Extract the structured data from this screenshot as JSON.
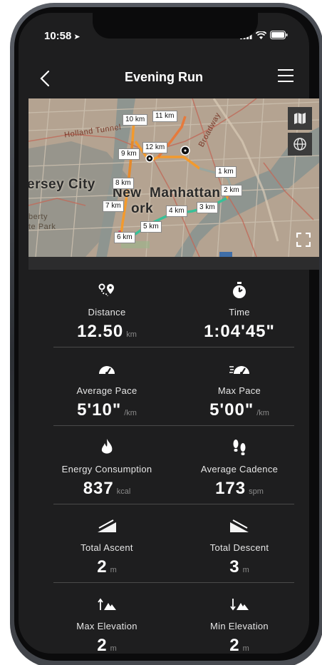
{
  "status_bar": {
    "time": "10:58",
    "location_glyph": "➤"
  },
  "header": {
    "title": "Evening Run",
    "back_icon": "chevron-left-icon",
    "menu_icon": "hamburger-menu-icon"
  },
  "map": {
    "labels": {
      "jersey_city": "ersey City",
      "new": "New",
      "york": "ork",
      "manhattan": "Manhattan",
      "holland_tunnel": "Holland Tunnel",
      "liberty_park": "berty",
      "state_park": "te Park",
      "broadway": "Broadway"
    },
    "km_markers": [
      "1 km",
      "2 km",
      "3 km",
      "4 km",
      "5 km",
      "6 km",
      "7 km",
      "8 km",
      "9 km",
      "10 km",
      "11 km",
      "12 km"
    ],
    "controls": {
      "map_style_icon": "map-icon",
      "globe_icon": "globe-icon",
      "fullscreen_icon": "fullscreen-icon"
    }
  },
  "stats": [
    {
      "left": {
        "icon": "route-icon",
        "label": "Distance",
        "value": "12.50",
        "unit": "km"
      },
      "right": {
        "icon": "stopwatch-icon",
        "label": "Time",
        "value": "1:04'45\"",
        "unit": ""
      }
    },
    {
      "left": {
        "icon": "speedometer-icon",
        "label": "Average Pace",
        "value": "5'10\"",
        "unit": "/km"
      },
      "right": {
        "icon": "fast-speedometer-icon",
        "label": "Max Pace",
        "value": "5'00\"",
        "unit": "/km"
      }
    },
    {
      "left": {
        "icon": "flame-icon",
        "label": "Energy Consumption",
        "value": "837",
        "unit": "kcal"
      },
      "right": {
        "icon": "footprints-icon",
        "label": "Average Cadence",
        "value": "173",
        "unit": "spm"
      }
    },
    {
      "left": {
        "icon": "ascent-icon",
        "label": "Total Ascent",
        "value": "2",
        "unit": "m"
      },
      "right": {
        "icon": "descent-icon",
        "label": "Total Descent",
        "value": "3",
        "unit": "m"
      }
    },
    {
      "left": {
        "icon": "max-elevation-icon",
        "label": "Max Elevation",
        "value": "2",
        "unit": "m"
      },
      "right": {
        "icon": "min-elevation-icon",
        "label": "Min Elevation",
        "value": "2",
        "unit": "m"
      }
    }
  ]
}
